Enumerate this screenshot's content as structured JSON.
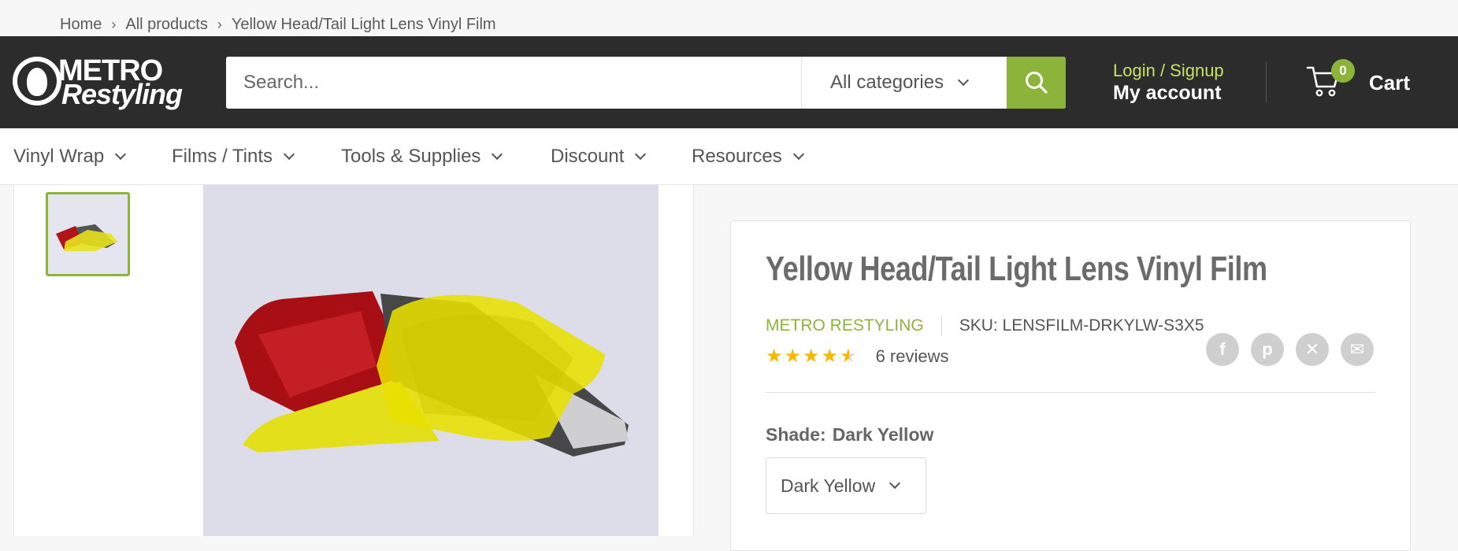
{
  "breadcrumb": [
    "Home",
    "All products",
    "Yellow Head/Tail Light Lens Vinyl Film"
  ],
  "logo": {
    "line1": "METRO",
    "line2": "Restyling"
  },
  "search": {
    "placeholder": "Search...",
    "category": "All categories"
  },
  "account": {
    "login": "Login / Signup",
    "my_account": "My account"
  },
  "cart": {
    "count": "0",
    "label": "Cart"
  },
  "nav": [
    "Vinyl Wrap",
    "Films / Tints",
    "Tools & Supplies",
    "Discount",
    "Resources"
  ],
  "product": {
    "title": "Yellow Head/Tail Light Lens Vinyl Film",
    "vendor": "METRO RESTYLING",
    "sku": "SKU: LENSFILM-DRKYLW-S3X5",
    "stars": "★★★★★",
    "reviews": "6 reviews",
    "rating": 4.5,
    "shade_label": "Shade:",
    "shade_value": "Dark Yellow",
    "shade_selected": "Dark Yellow"
  },
  "share": [
    "facebook-icon",
    "pinterest-icon",
    "x-icon",
    "email-icon"
  ],
  "colors": {
    "accent": "#8cb43a",
    "header": "#2c2c2c",
    "star": "#f6b900",
    "login": "#c5e264"
  }
}
